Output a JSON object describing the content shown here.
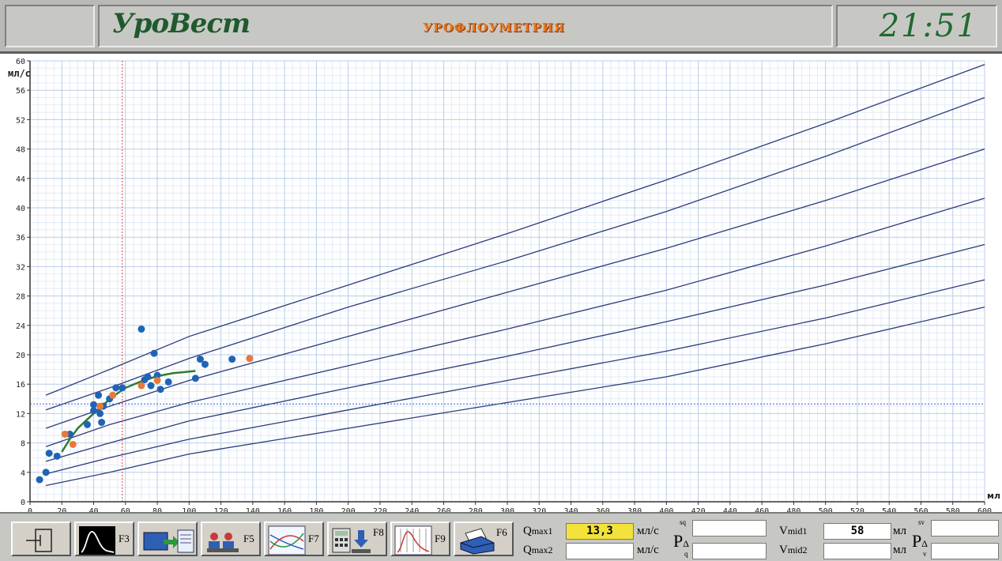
{
  "header": {
    "logo": "УроВест",
    "title": "УРОФЛОУМЕТРИЯ",
    "clock": "21:51"
  },
  "chart_data": {
    "type": "scatter",
    "ylabel": "мл/с",
    "xlabel": "мл",
    "xlim": [
      0,
      600
    ],
    "ylim": [
      0,
      60
    ],
    "x_ticks": [
      0,
      20,
      40,
      60,
      80,
      100,
      120,
      140,
      160,
      180,
      200,
      220,
      240,
      260,
      280,
      300,
      320,
      340,
      360,
      380,
      400,
      420,
      440,
      460,
      480,
      500,
      520,
      540,
      560,
      580,
      600
    ],
    "y_ticks": [
      0,
      4,
      8,
      12,
      16,
      20,
      24,
      28,
      32,
      36,
      40,
      44,
      48,
      52,
      56,
      60
    ],
    "grid": true,
    "ref_lines": {
      "vertical_x": 58,
      "horizontal_y": 13.3
    },
    "nomogram_curves": [
      {
        "values": [
          [
            10,
            14.5
          ],
          [
            50,
            18
          ],
          [
            100,
            22.5
          ],
          [
            200,
            29.5
          ],
          [
            300,
            36.5
          ],
          [
            400,
            43.8
          ],
          [
            500,
            51.5
          ],
          [
            600,
            59.5
          ]
        ]
      },
      {
        "values": [
          [
            10,
            12.5
          ],
          [
            50,
            15.5
          ],
          [
            100,
            19.5
          ],
          [
            200,
            26.5
          ],
          [
            300,
            32.8
          ],
          [
            400,
            39.5
          ],
          [
            500,
            47
          ],
          [
            600,
            55
          ]
        ]
      },
      {
        "values": [
          [
            10,
            10
          ],
          [
            50,
            13
          ],
          [
            100,
            16.5
          ],
          [
            200,
            22.5
          ],
          [
            300,
            28.5
          ],
          [
            400,
            34.5
          ],
          [
            500,
            41
          ],
          [
            600,
            48
          ]
        ]
      },
      {
        "values": [
          [
            10,
            7.5
          ],
          [
            50,
            10.5
          ],
          [
            100,
            13.5
          ],
          [
            200,
            18.5
          ],
          [
            300,
            23.5
          ],
          [
            400,
            28.8
          ],
          [
            500,
            34.8
          ],
          [
            600,
            41.3
          ]
        ]
      },
      {
        "values": [
          [
            10,
            5.5
          ],
          [
            50,
            8
          ],
          [
            100,
            11
          ],
          [
            200,
            15.5
          ],
          [
            300,
            19.8
          ],
          [
            400,
            24.5
          ],
          [
            500,
            29.5
          ],
          [
            600,
            35
          ]
        ]
      },
      {
        "values": [
          [
            10,
            3.8
          ],
          [
            50,
            6
          ],
          [
            100,
            8.5
          ],
          [
            200,
            12.5
          ],
          [
            300,
            16.5
          ],
          [
            400,
            20.5
          ],
          [
            500,
            25
          ],
          [
            600,
            30.2
          ]
        ]
      },
      {
        "values": [
          [
            10,
            2.2
          ],
          [
            50,
            4
          ],
          [
            100,
            6.5
          ],
          [
            200,
            10
          ],
          [
            300,
            13.5
          ],
          [
            400,
            17
          ],
          [
            500,
            21.5
          ],
          [
            600,
            26.5
          ]
        ]
      }
    ],
    "series": [
      {
        "color": "#1f63b7",
        "points": [
          [
            6,
            3
          ],
          [
            10,
            4
          ],
          [
            12,
            6.6
          ],
          [
            17,
            6.2
          ],
          [
            25,
            9.2
          ],
          [
            36,
            10.5
          ],
          [
            40,
            12.4
          ],
          [
            40,
            13.2
          ],
          [
            43,
            14.5
          ],
          [
            44,
            12
          ],
          [
            45,
            10.8
          ],
          [
            46,
            13
          ],
          [
            50,
            14
          ],
          [
            54,
            15.5
          ],
          [
            58,
            15.5
          ],
          [
            70,
            23.5
          ],
          [
            72,
            16.6
          ],
          [
            74,
            17
          ],
          [
            76,
            15.8
          ],
          [
            78,
            20.2
          ],
          [
            80,
            17.2
          ],
          [
            82,
            15.3
          ],
          [
            87,
            16.3
          ],
          [
            104,
            16.8
          ],
          [
            107,
            19.4
          ],
          [
            110,
            18.7
          ],
          [
            127,
            19.4
          ]
        ]
      },
      {
        "color": "#e8793a",
        "points": [
          [
            22,
            9.2
          ],
          [
            27,
            7.8
          ],
          [
            44,
            13
          ],
          [
            52,
            14.5
          ],
          [
            70,
            15.8
          ],
          [
            80,
            16.5
          ],
          [
            138,
            19.5
          ]
        ]
      }
    ],
    "fit_line": {
      "color": "#2e7d32",
      "points": [
        [
          20,
          6.8
        ],
        [
          25,
          8.5
        ],
        [
          30,
          10
        ],
        [
          38,
          11.6
        ],
        [
          45,
          13
        ],
        [
          52,
          14.3
        ],
        [
          60,
          15.5
        ],
        [
          70,
          16.4
        ],
        [
          80,
          17.1
        ],
        [
          90,
          17.5
        ],
        [
          104,
          17.8
        ]
      ]
    }
  },
  "footer": {
    "buttons": [
      {
        "key": "",
        "icon": "exit-icon"
      },
      {
        "key": "F3",
        "icon": "flow-curve-icon"
      },
      {
        "key": "",
        "icon": "folder-transfer-icon"
      },
      {
        "key": "F5",
        "icon": "patients-icon"
      },
      {
        "key": "F7",
        "icon": "nomogram-icon"
      },
      {
        "key": "F8",
        "icon": "calculator-save-icon"
      },
      {
        "key": "F9",
        "icon": "compare-curves-icon"
      },
      {
        "key": "F6",
        "icon": "printer-icon"
      }
    ],
    "qmax1_label": "Q",
    "qmax1_sub": "max1",
    "qmax1_value": "13,3",
    "qmax1_unit": "мл/с",
    "qmax2_label": "Q",
    "qmax2_sub": "max2",
    "qmax2_value": "",
    "qmax2_unit": "мл/с",
    "p_label": "P",
    "p_sub": "Δ",
    "p_sup1": "sq",
    "p_sup2": "q",
    "vmid1_label": "V",
    "vmid1_sub": "mid1",
    "vmid1_value": "58",
    "vmid1_unit": "мл",
    "vmid2_label": "V",
    "vmid2_sub": "mid2",
    "vmid2_value": "",
    "vmid2_unit": "мл",
    "pv_label": "P",
    "pv_sub": "Δ",
    "pv_sup1": "sv",
    "pv_sup2": "v",
    "highlight_color": "#f3e23a"
  }
}
